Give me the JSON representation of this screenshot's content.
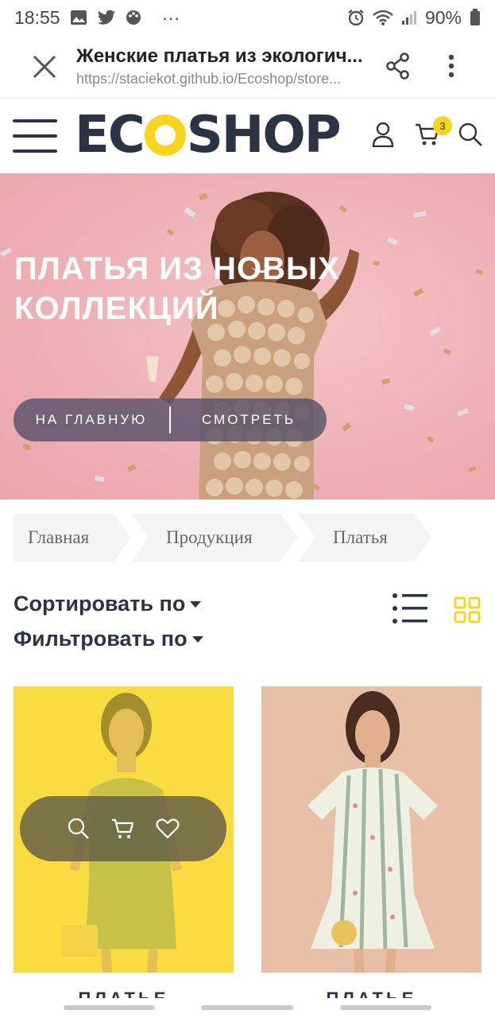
{
  "status_bar": {
    "time": "18:55",
    "more": "···",
    "battery": "90%"
  },
  "browser": {
    "title": "Женские платья из экологич...",
    "url": "https://staciekot.github.io/Ecoshop/store..."
  },
  "header": {
    "logo_left": "EC",
    "logo_right": "SHOP",
    "cart_count": "3",
    "accent": "#f7d51d",
    "dark": "#2c3345"
  },
  "hero": {
    "title": "ПЛАТЬЯ ИЗ НОВЫХ КОЛЛЕКЦИЙ",
    "btn_home": "НА ГЛАВНУЮ",
    "btn_view": "СМОТРЕТЬ"
  },
  "breadcrumb": [
    "Главная",
    "Продукция",
    "Платья"
  ],
  "controls": {
    "sort": "Сортировать по",
    "filter": "Фильтровать по"
  },
  "products": [
    {
      "name": "ПЛАТЬЕ"
    },
    {
      "name": "ПЛАТЬЕ"
    }
  ]
}
